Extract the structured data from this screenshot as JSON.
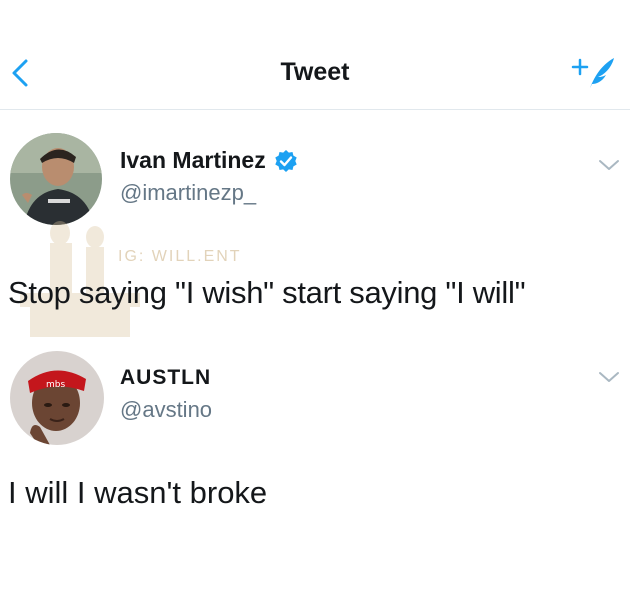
{
  "header": {
    "back_icon": "chevron-left-icon",
    "title": "Tweet",
    "compose_icon": "compose-tweet-icon",
    "accent_color": "#1da1f2"
  },
  "tweets": [
    {
      "name": "Ivan Martinez",
      "verified": true,
      "handle": "@imartinezp_",
      "text": "Stop saying \"I wish\" start saying \"I will\"",
      "watermark": "IG: WILL.ENT"
    },
    {
      "name": "AUSTLN",
      "verified": false,
      "handle": "@avstino",
      "text": "I will I wasn't broke"
    }
  ]
}
